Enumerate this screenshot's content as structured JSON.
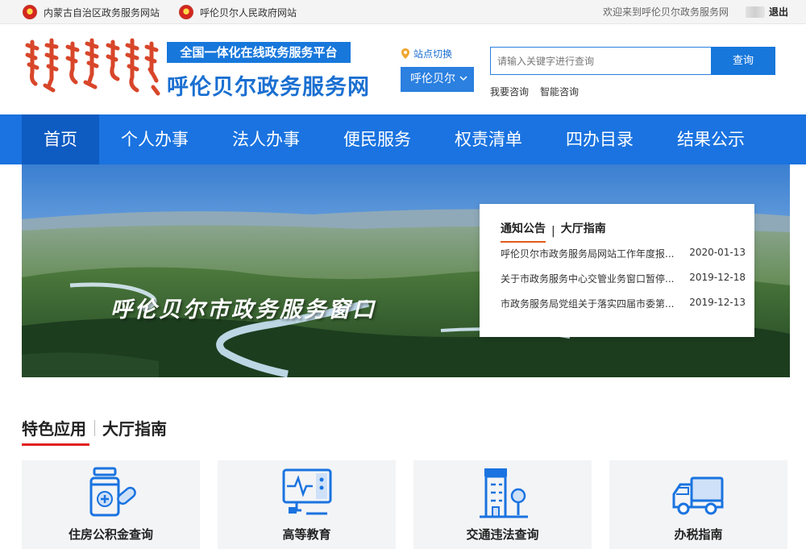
{
  "topbar": {
    "link1": "内蒙古自治区政务服务网站",
    "link2": "呼伦贝尔人民政府网站",
    "welcome": "欢迎来到呼伦贝尔政务服务网",
    "logout": "退出"
  },
  "header": {
    "platform_badge": "全国一体化在线政务服务平台",
    "site_name": "呼伦贝尔政务服务网",
    "switch_label": "站点切换",
    "city": "呼伦贝尔",
    "search_placeholder": "请输入关键字进行查询",
    "search_button": "查询",
    "quick_links": [
      "我要咨询",
      "智能咨询"
    ]
  },
  "nav": {
    "items": [
      "首页",
      "个人办事",
      "法人办事",
      "便民服务",
      "权责清单",
      "四办目录",
      "结果公示"
    ],
    "active_index": 0
  },
  "banner": {
    "title": "呼伦贝尔市政务服务窗口",
    "notice": {
      "tab_active": "通知公告",
      "tab_other": "大厅指南",
      "items": [
        {
          "title": "呼伦贝尔市政务服务局网站工作年度报...",
          "date": "2020-01-13"
        },
        {
          "title": "关于市政务服务中心交管业务窗口暂停...",
          "date": "2019-12-18"
        },
        {
          "title": "市政务服务局党组关于落实四届市委第...",
          "date": "2019-12-13"
        }
      ]
    }
  },
  "features": {
    "tab_active": "特色应用",
    "tab_other": "大厅指南",
    "cards": [
      {
        "label": "住房公积金查询",
        "icon": "medicine-icon"
      },
      {
        "label": "高等教育",
        "icon": "monitor-icon"
      },
      {
        "label": "交通违法查询",
        "icon": "building-icon"
      },
      {
        "label": "办税指南",
        "icon": "truck-icon"
      }
    ]
  },
  "colors": {
    "primary_blue": "#1a73e0",
    "active_nav": "#0e5bc2",
    "accent_red": "#e02020",
    "accent_orange": "#e05d1c"
  }
}
